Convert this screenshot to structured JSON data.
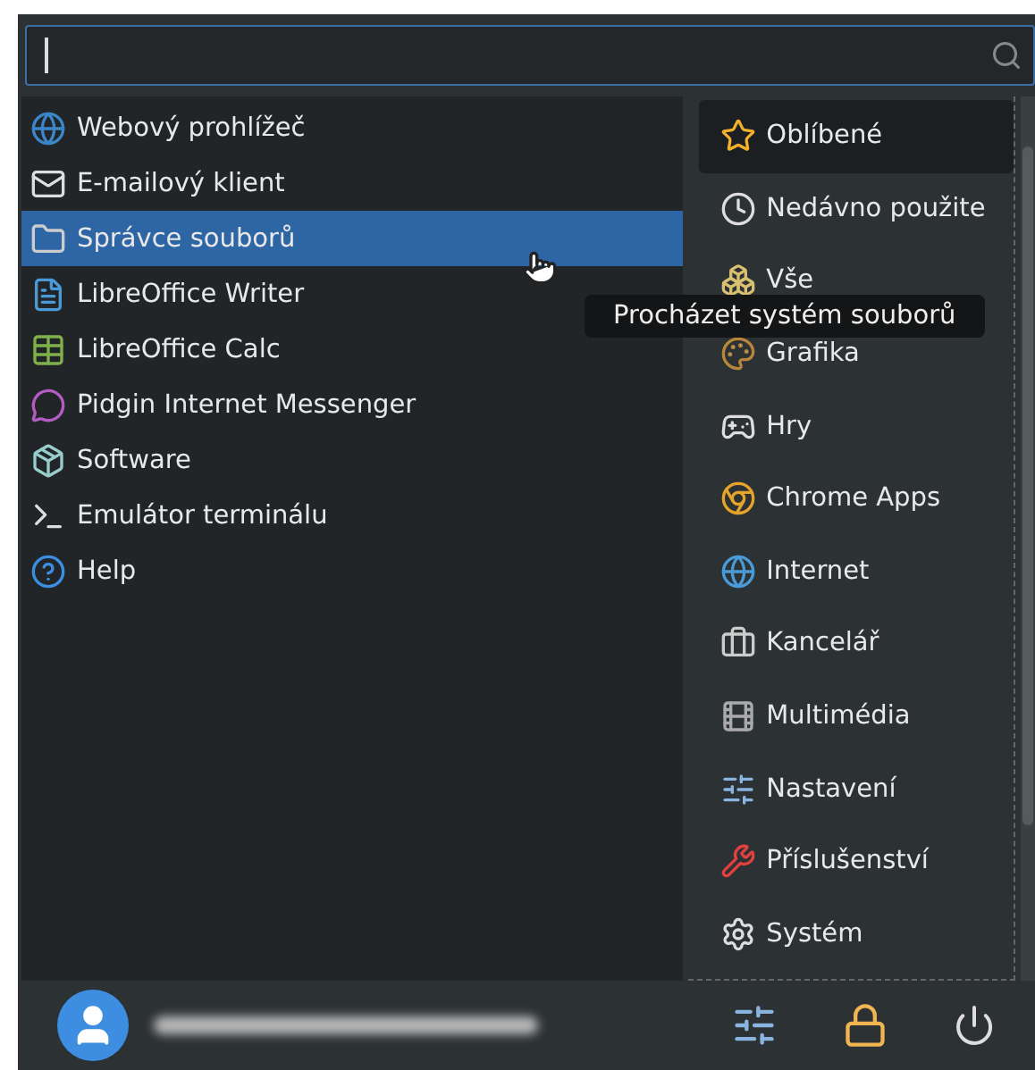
{
  "search": {
    "focused": true
  },
  "apps": [
    {
      "label": "Webový prohlížeč",
      "selected": false
    },
    {
      "label": "E-mailový klient",
      "selected": false
    },
    {
      "label": "Správce souborů",
      "selected": true
    },
    {
      "label": "LibreOffice Writer",
      "selected": false
    },
    {
      "label": "LibreOffice Calc",
      "selected": false
    },
    {
      "label": "Pidgin Internet Messenger",
      "selected": false
    },
    {
      "label": "Software",
      "selected": false
    },
    {
      "label": "Emulátor terminálu",
      "selected": false
    },
    {
      "label": "Help",
      "selected": false
    }
  ],
  "categories": [
    {
      "label": "Oblíbené",
      "selected": true
    },
    {
      "label": "Nedávno použite",
      "selected": false
    },
    {
      "label": "Vše",
      "selected": false
    },
    {
      "label": "Grafika",
      "selected": false
    },
    {
      "label": "Hry",
      "selected": false
    },
    {
      "label": "Chrome Apps",
      "selected": false
    },
    {
      "label": "Internet",
      "selected": false
    },
    {
      "label": "Kancelář",
      "selected": false
    },
    {
      "label": "Multimédia",
      "selected": false
    },
    {
      "label": "Nastavení",
      "selected": false
    },
    {
      "label": "Příslušenství",
      "selected": false
    },
    {
      "label": "Systém",
      "selected": false
    }
  ],
  "tooltip": "Procházet systém souborů"
}
